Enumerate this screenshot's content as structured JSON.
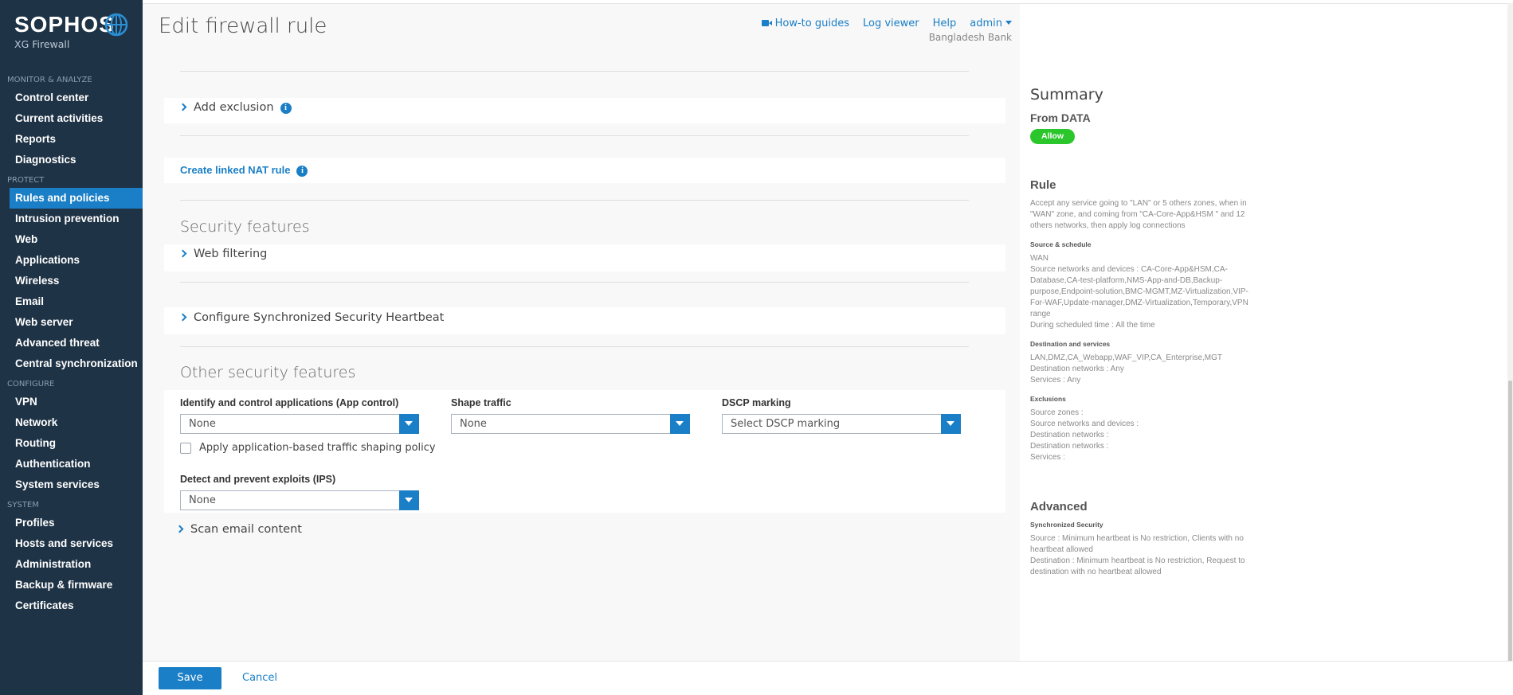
{
  "brand": {
    "name": "SOPHOS",
    "product": "XG Firewall"
  },
  "nav": [
    {
      "section": "MONITOR & ANALYZE",
      "items": [
        "Control center",
        "Current activities",
        "Reports",
        "Diagnostics"
      ]
    },
    {
      "section": "PROTECT",
      "items": [
        "Rules and policies",
        "Intrusion prevention",
        "Web",
        "Applications",
        "Wireless",
        "Email",
        "Web server",
        "Advanced threat",
        "Central synchronization"
      ]
    },
    {
      "section": "CONFIGURE",
      "items": [
        "VPN",
        "Network",
        "Routing",
        "Authentication",
        "System services"
      ]
    },
    {
      "section": "SYSTEM",
      "items": [
        "Profiles",
        "Hosts and services",
        "Administration",
        "Backup & firmware",
        "Certificates"
      ]
    }
  ],
  "active_nav": "Rules and policies",
  "header": {
    "title": "Edit firewall rule",
    "links": {
      "howto": "How-to guides",
      "log": "Log viewer",
      "help": "Help",
      "admin": "admin"
    },
    "org": "Bangladesh Bank"
  },
  "form": {
    "add_exclusion": "Add exclusion",
    "create_nat": "Create linked NAT rule",
    "security_features": "Security features",
    "web_filtering": "Web filtering",
    "heartbeat": "Configure Synchronized Security Heartbeat",
    "other_security": "Other security features",
    "app_control_label": "Identify and control applications (App control)",
    "app_control_value": "None",
    "shape_traffic_label": "Shape traffic",
    "shape_traffic_value": "None",
    "dscp_label": "DSCP marking",
    "dscp_value": "Select DSCP marking",
    "app_shaping_label": "Apply application-based traffic shaping policy",
    "app_shaping_checked": false,
    "ips_label": "Detect and prevent exploits (IPS)",
    "ips_value": "None",
    "scan_email": "Scan email content"
  },
  "summary": {
    "title": "Summary",
    "from": "From DATA",
    "action": "Allow",
    "rule_heading": "Rule",
    "rule_text": "Accept any service going to \"LAN\" or 5 others zones, when in \"WAN\" zone, and coming from \"CA-Core-App&HSM \" and 12 others networks, then apply log connections",
    "source_heading": "Source & schedule",
    "source_zone": "WAN",
    "source_networks": "Source networks and devices : CA-Core-App&HSM,CA-Database,CA-test-platform,NMS-App-and-DB,Backup-purpose,Endpoint-solution,BMC-MGMT,MZ-Virtualization,VIP-For-WAF,Update-manager,DMZ-Virtualization,Temporary,VPN range",
    "schedule": "During scheduled time : All the time",
    "dest_heading": "Destination and services",
    "dest_zones": "LAN,DMZ,CA_Webapp,WAF_VIP,CA_Enterprise,MGT",
    "dest_networks": "Destination networks : Any",
    "services": "Services : Any",
    "excl_heading": "Exclusions",
    "excl_source_zones": "Source zones :",
    "excl_source_networks": "Source networks and devices :",
    "excl_dest_networks_1": "Destination networks :",
    "excl_dest_networks_2": "Destination networks :",
    "excl_services": "Services :",
    "advanced_heading": "Advanced",
    "sync_heading": "Synchronized Security",
    "sync_source": "Source : Minimum heartbeat is No restriction, Clients with no heartbeat allowed",
    "sync_dest": "Destination : Minimum heartbeat is No restriction, Request to destination with no heartbeat allowed"
  },
  "footer": {
    "save": "Save",
    "cancel": "Cancel"
  },
  "colors": {
    "sidebar": "#1f3346",
    "accent": "#1a7fc6",
    "allow": "#2bc62b"
  }
}
